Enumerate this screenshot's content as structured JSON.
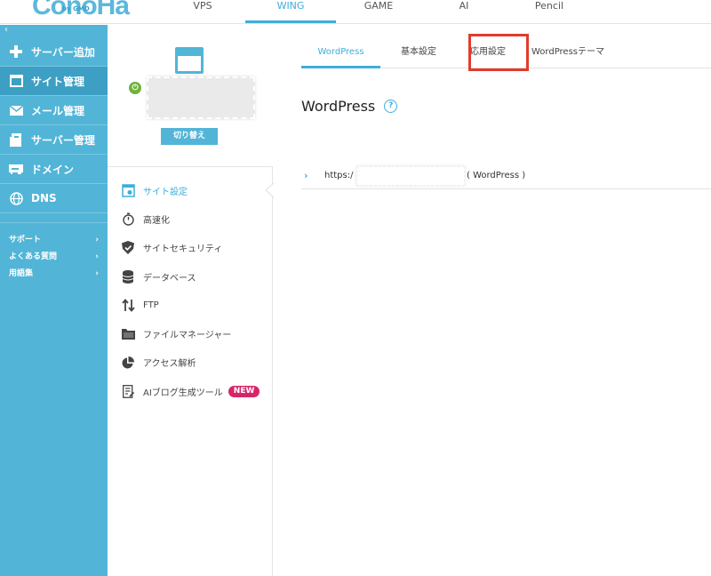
{
  "topnav": {
    "logo": "ConoHa",
    "logo_sub": "by GMO",
    "items": [
      "VPS",
      "WING",
      "GAME",
      "AI",
      "Pencil"
    ],
    "active": "WING"
  },
  "sidebar": {
    "collapse_icon": "chevron-left-icon",
    "items": [
      {
        "label": "サーバー追加",
        "icon": "plus-icon"
      },
      {
        "label": "サイト管理",
        "icon": "window-icon"
      },
      {
        "label": "メール管理",
        "icon": "mail-icon"
      },
      {
        "label": "サーバー管理",
        "icon": "server-icon"
      },
      {
        "label": "ドメイン",
        "icon": "domain-icon"
      },
      {
        "label": "DNS",
        "icon": "globe-icon"
      }
    ],
    "sub": [
      "サポート",
      "よくある質問",
      "用語集"
    ]
  },
  "site_card": {
    "switch_label": "切り替え"
  },
  "menu": [
    {
      "label": "サイト設定",
      "icon": "site-settings-icon"
    },
    {
      "label": "高速化",
      "icon": "stopwatch-icon"
    },
    {
      "label": "サイトセキュリティ",
      "icon": "shield-icon"
    },
    {
      "label": "データベース",
      "icon": "database-icon"
    },
    {
      "label": "FTP",
      "icon": "transfer-icon"
    },
    {
      "label": "ファイルマネージャー",
      "icon": "folder-icon"
    },
    {
      "label": "アクセス解析",
      "icon": "pie-chart-icon"
    },
    {
      "label": "AIブログ生成ツール",
      "icon": "document-icon",
      "badge": "NEW"
    }
  ],
  "main": {
    "tabs": [
      "WordPress",
      "基本設定",
      "応用設定",
      "WordPressテーマ"
    ],
    "active_tab": "WordPress",
    "heading": "WordPress",
    "help": "?",
    "site_row": {
      "url_prefix": "https:/",
      "suffix": "( WordPress )"
    }
  },
  "colors": {
    "accent": "#3eaedb",
    "sidebar": "#52b5d7",
    "highlight": "#e23b2c",
    "badge": "#d6266a"
  }
}
